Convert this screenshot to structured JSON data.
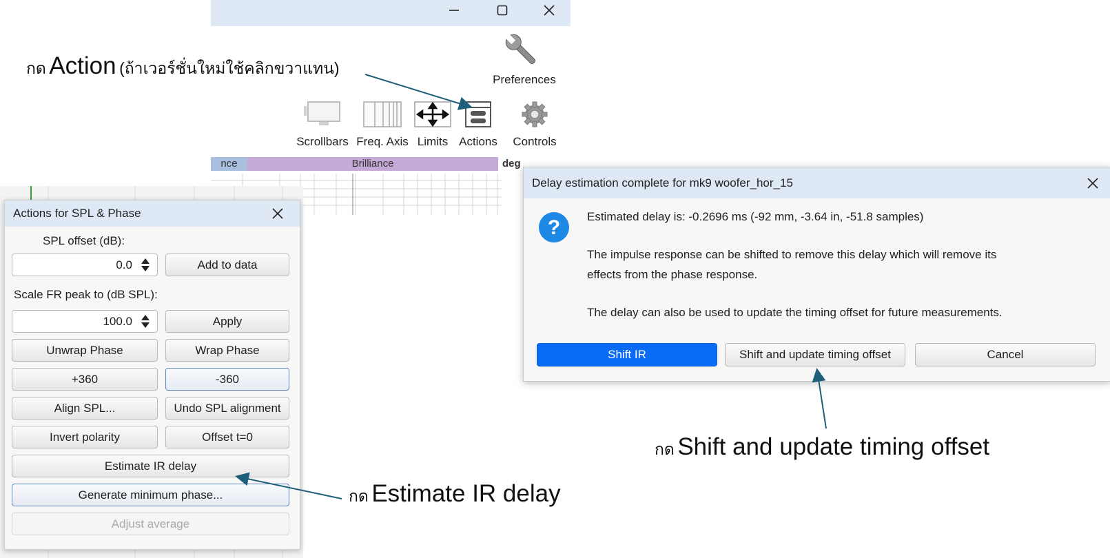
{
  "main_window": {
    "toolbar": {
      "preferences": "Preferences",
      "scrollbars": "Scrollbars",
      "freq_axis": "Freq. Axis",
      "limits": "Limits",
      "actions": "Actions",
      "controls": "Controls"
    },
    "bands": {
      "presence_partial": "nce",
      "brilliance": "Brilliance",
      "deg_label": "deg"
    },
    "colors": {
      "presence": "#a9bfe0",
      "brilliance": "#c5a9d6",
      "titlebar": "#dfe8f5"
    }
  },
  "actions_dialog": {
    "title": "Actions for SPL & Phase",
    "spl_offset_label": "SPL offset (dB):",
    "spl_offset_value": "0.0",
    "add_to_data": "Add to data",
    "scale_label": "Scale FR peak to (dB SPL):",
    "scale_value": "100.0",
    "apply": "Apply",
    "unwrap_phase": "Unwrap Phase",
    "wrap_phase": "Wrap Phase",
    "plus360": "+360",
    "minus360": "-360",
    "align_spl": "Align SPL...",
    "undo_spl": "Undo SPL alignment",
    "invert_polarity": "Invert polarity",
    "offset_t0": "Offset t=0",
    "estimate_ir": "Estimate IR delay",
    "generate_min_phase": "Generate minimum phase...",
    "adjust_average": "Adjust average"
  },
  "delay_dialog": {
    "title": "Delay estimation complete for mk9 woofer_hor_15",
    "line1": "Estimated delay is: -0.2696 ms (-92 mm, -3.64 in, -51.8 samples)",
    "line2a": "The impulse response can be shifted to remove this delay which will remove its",
    "line2b": "effects from the phase response.",
    "line3": "The delay can also be used to update the timing offset for future measurements.",
    "shift_ir": "Shift IR",
    "shift_update": "Shift and update timing offset",
    "cancel": "Cancel",
    "colors": {
      "primary": "#0a6cf5",
      "question_icon": "#1e88e5"
    }
  },
  "annotations": {
    "action": {
      "thai_press": "กด",
      "main": "Action",
      "note": "(ถ้าเวอร์ชั่นใหม่ใช้คลิกขวาแทน)"
    },
    "estimate": {
      "thai_press": "กด",
      "main": "Estimate IR delay"
    },
    "shift": {
      "thai_press": "กด",
      "main": "Shift and update timing offset"
    },
    "arrow_color": "#1f5f7a"
  }
}
